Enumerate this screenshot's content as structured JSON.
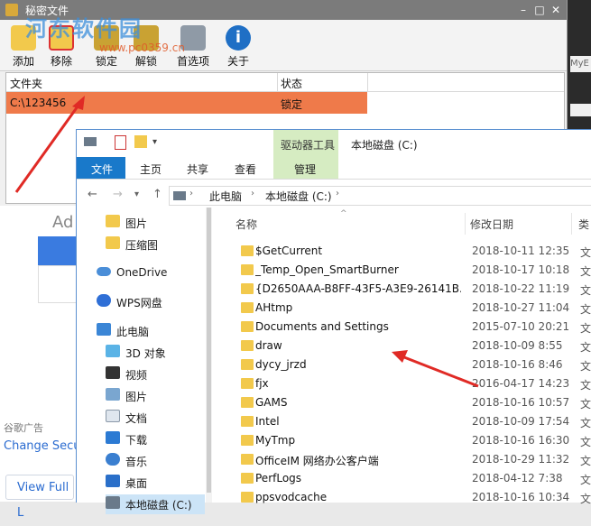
{
  "app": {
    "title": "秘密文件",
    "watermark": "河东软件园",
    "watermark_url": "www.pc0359.cn",
    "toolbar": [
      "添加",
      "移除",
      "锁定",
      "解锁",
      "首选项",
      "关于"
    ],
    "table": {
      "headers": [
        "文件夹",
        "状态"
      ],
      "rows": [
        {
          "folder": "C:\\123456",
          "status": "锁定"
        }
      ]
    },
    "colors": {
      "selected_row": "#ef7a4a",
      "titlebar": "#7b7b7b"
    }
  },
  "background": {
    "partial_text": "Ad",
    "ad_label": "谷歌广告",
    "change_link": "Change Secu",
    "view_button": "View Full L",
    "right_tab": "MyE"
  },
  "explorer": {
    "context_tab": "驱动器工具",
    "title": "本地磁盘 (C:)",
    "ribbon_tabs": [
      "文件",
      "主页",
      "共享",
      "查看",
      "管理"
    ],
    "breadcrumb": [
      "此电脑",
      "本地磁盘 (C:)"
    ],
    "nav": [
      {
        "label": "图片",
        "icon": "folder-icon"
      },
      {
        "label": "压缩图",
        "icon": "folder-icon"
      },
      {
        "label": "OneDrive",
        "icon": "cloud-icon"
      },
      {
        "label": "WPS网盘",
        "icon": "wps-cloud-icon"
      },
      {
        "label": "此电脑",
        "icon": "computer-icon"
      },
      {
        "label": "3D 对象",
        "icon": "cube-icon"
      },
      {
        "label": "视频",
        "icon": "video-icon"
      },
      {
        "label": "图片",
        "icon": "picture-icon"
      },
      {
        "label": "文档",
        "icon": "document-icon"
      },
      {
        "label": "下载",
        "icon": "download-icon"
      },
      {
        "label": "音乐",
        "icon": "music-icon"
      },
      {
        "label": "桌面",
        "icon": "desktop-icon"
      },
      {
        "label": "本地磁盘 (C:)",
        "icon": "drive-icon"
      }
    ],
    "columns": [
      "名称",
      "修改日期",
      "类"
    ],
    "files": [
      {
        "name": "$GetCurrent",
        "date": "2018-10-11 12:35",
        "type": "文"
      },
      {
        "name": "_Temp_Open_SmartBurner",
        "date": "2018-10-17 10:18",
        "type": "文"
      },
      {
        "name": "{D2650AAA-B8FF-43F5-A3E9-26141B...",
        "date": "2018-10-22 11:19",
        "type": "文"
      },
      {
        "name": "AHtmp",
        "date": "2018-10-27 11:04",
        "type": "文"
      },
      {
        "name": "Documents and Settings",
        "date": "2015-07-10 20:21",
        "type": "文"
      },
      {
        "name": "draw",
        "date": "2018-10-09 8:55",
        "type": "文"
      },
      {
        "name": "dycy_jrzd",
        "date": "2018-10-16 8:46",
        "type": "文"
      },
      {
        "name": "fjx",
        "date": "2016-04-17 14:23",
        "type": "文"
      },
      {
        "name": "GAMS",
        "date": "2018-10-16 10:57",
        "type": "文"
      },
      {
        "name": "Intel",
        "date": "2018-10-09 17:54",
        "type": "文"
      },
      {
        "name": "MyTmp",
        "date": "2018-10-16 16:30",
        "type": "文"
      },
      {
        "name": "OfficeIM 网络办公客户端",
        "date": "2018-10-29 11:32",
        "type": "文"
      },
      {
        "name": "PerfLogs",
        "date": "2018-04-12 7:38",
        "type": "文"
      },
      {
        "name": "ppsvodcache",
        "date": "2018-10-16 10:34",
        "type": "文"
      }
    ]
  }
}
